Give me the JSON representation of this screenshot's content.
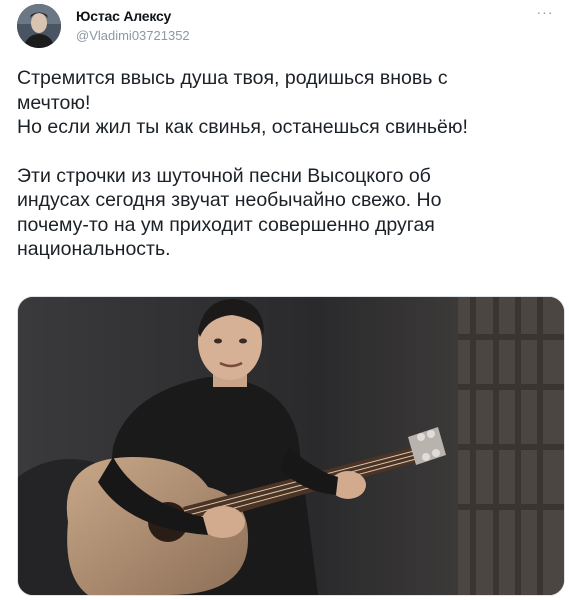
{
  "author": {
    "name": "Юстас Алексу",
    "handle": "@Vladimi03721352",
    "avatar_icon": "avatar-photo"
  },
  "menu": {
    "icon": "more-horizontal-icon",
    "glyph": "···"
  },
  "tweet": {
    "paragraph1": [
      "Стремится ввысь душа твоя, родишься вновь с",
      "мечтою!",
      "Но если жил ты как свинья, останешься свиньёю!"
    ],
    "paragraph2": [
      "Эти строчки из шуточной песни Высоцкого об",
      "индусах сегодня звучат необычайно свежо. Но",
      "почему-то на ум приходит совершенно другая",
      "национальность."
    ]
  },
  "media": {
    "icon": "photo-man-with-guitar"
  },
  "colors": {
    "text": "#1b2127",
    "secondary": "#8b98a5",
    "background": "#ffffff"
  }
}
